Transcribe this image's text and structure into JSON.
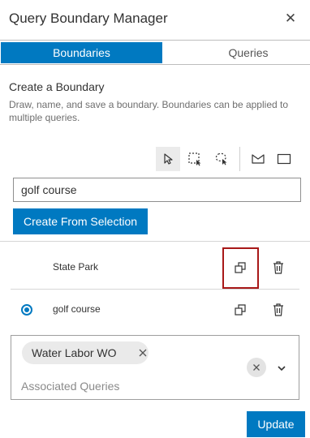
{
  "window": {
    "title": "Query Boundary Manager",
    "close_icon": "close-icon"
  },
  "tabs": [
    {
      "label": "Boundaries",
      "active": true
    },
    {
      "label": "Queries",
      "active": false
    }
  ],
  "create": {
    "title": "Create a Boundary",
    "description": "Draw, name, and save a boundary. Boundaries can be applied to multiple queries.",
    "tools": [
      {
        "icon": "cursor-select-icon",
        "selected": true
      },
      {
        "icon": "rectangle-select-icon",
        "selected": false
      },
      {
        "icon": "lasso-select-icon",
        "selected": false
      },
      {
        "icon": "polygon-draw-icon",
        "selected": false
      },
      {
        "icon": "rectangle-draw-icon",
        "selected": false
      }
    ],
    "name_value": "golf course",
    "create_button": "Create From Selection"
  },
  "boundaries": [
    {
      "name": "State Park",
      "selected": false,
      "duplicate_icon": "duplicate-icon",
      "delete_icon": "trash-icon"
    },
    {
      "name": "golf course",
      "selected": true,
      "duplicate_icon": "duplicate-icon",
      "delete_icon": "trash-icon"
    }
  ],
  "associated": {
    "chips": [
      "Water Labor WO"
    ],
    "placeholder": "Associated Queries"
  },
  "update_button": "Update",
  "colors": {
    "accent": "#0079c1",
    "highlight_border": "#a81818"
  }
}
